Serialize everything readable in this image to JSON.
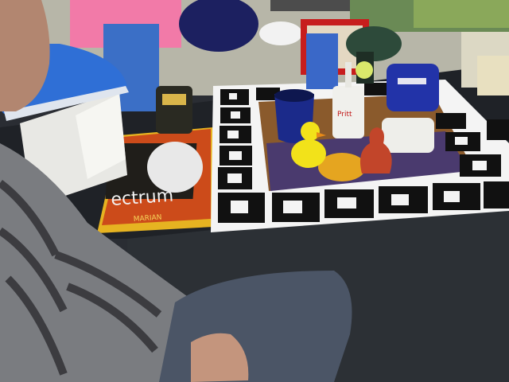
{
  "scene": {
    "magazine_title": "ectrum",
    "magazine_brand": "MARIAN",
    "bottle_label": "Pritt"
  },
  "colors": {
    "floor": "#2a2d33",
    "table_mat": "#f4f4f4",
    "marker_black": "#111111",
    "duck_yellow": "#f2e21a",
    "mug_blue": "#1b2a8a",
    "stapler_blue": "#2233a8",
    "iron_blue": "#2f6fd6",
    "sweater_gray": "#7a7c80",
    "jeans_blue": "#4b5566"
  },
  "icons": [
    "fiducial-marker",
    "rubber-duck",
    "mug",
    "glue-bottle",
    "stapler",
    "drill",
    "toy-car",
    "clay-figure",
    "egg-carton",
    "iron",
    "box"
  ]
}
